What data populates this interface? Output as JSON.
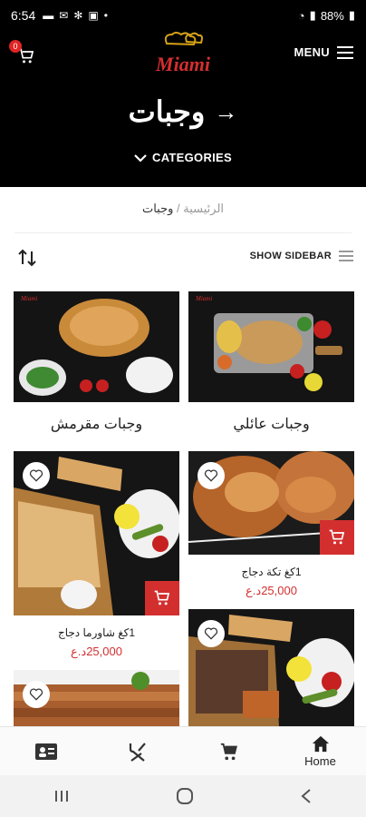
{
  "status_bar": {
    "time": "6:54",
    "battery": "88%"
  },
  "header": {
    "cart_count": "0",
    "logo_text": "Miami",
    "menu_label": "MENU",
    "title": "وجبات",
    "categories_label": "CATEGORIES"
  },
  "breadcrumb": {
    "home": "الرئيسية",
    "separator": "/",
    "current": "وجبات"
  },
  "toolbar": {
    "show_sidebar": "SHOW SIDEBAR"
  },
  "category_cards": [
    {
      "label": "وجبات مقرمش"
    },
    {
      "label": "وجبات عائلي"
    }
  ],
  "products": [
    {
      "name": "1كغ شاورما دجاج",
      "price": "25,000د.ع"
    },
    {
      "name": "1كغ تكة دجاج",
      "price": "25,000د.ع"
    },
    {
      "name": "",
      "price": ""
    },
    {
      "name": "",
      "price": ""
    }
  ],
  "bottom_nav": {
    "home_label": "Home"
  },
  "colors": {
    "accent": "#d32f2f",
    "header_bg": "#000000"
  }
}
